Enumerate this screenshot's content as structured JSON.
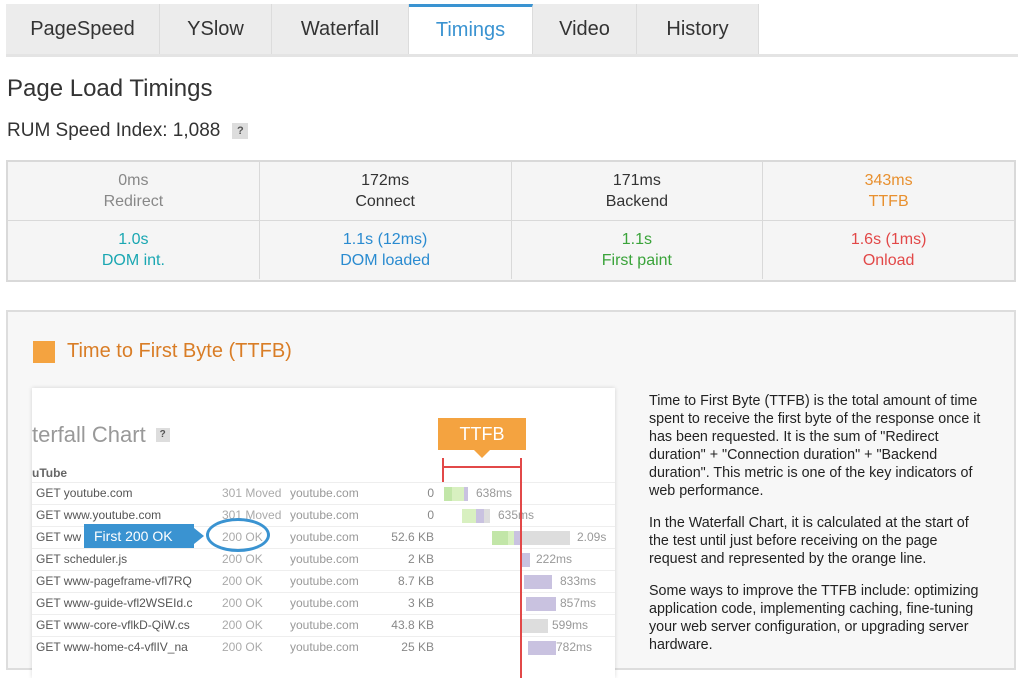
{
  "tabs": [
    "PageSpeed",
    "YSlow",
    "Waterfall",
    "Timings",
    "Video",
    "History"
  ],
  "active_tab": "Timings",
  "page_title": "Page Load Timings",
  "rum": {
    "label": "RUM Speed Index: 1,088",
    "help": "?"
  },
  "timings": {
    "row1": [
      {
        "value": "0ms",
        "label": "Redirect",
        "color": "#888888"
      },
      {
        "value": "172ms",
        "label": "Connect",
        "color": "#333333"
      },
      {
        "value": "171ms",
        "label": "Backend",
        "color": "#333333"
      },
      {
        "value": "343ms",
        "label": "TTFB",
        "color": "#e8902f"
      }
    ],
    "row2": [
      {
        "value": "1.0s",
        "label": "DOM int.",
        "color": "#1aa7b2"
      },
      {
        "value": "1.1s (12ms)",
        "label": "DOM loaded",
        "color": "#2a8bd0"
      },
      {
        "value": "1.1s",
        "label": "First paint",
        "color": "#3aa33a"
      },
      {
        "value": "1.6s (1ms)",
        "label": "Onload",
        "color": "#e24848"
      }
    ]
  },
  "panel": {
    "title": "Time to First Byte (TTFB)",
    "accent": "#f4a340",
    "screenshot": {
      "title": "terfall Chart",
      "help": "?",
      "group": "uTube",
      "ttfb_tag": "TTFB",
      "callout": "First 200 OK",
      "rows": [
        {
          "req": "GET youtube.com",
          "status": "301 Moved",
          "domain": "youtube.com",
          "size": "0",
          "time": "638ms"
        },
        {
          "req": "GET www.youtube.com",
          "status": "301 Moved",
          "domain": "youtube.com",
          "size": "0",
          "time": "635ms"
        },
        {
          "req": "GET ww",
          "status": "200 OK",
          "domain": "youtube.com",
          "size": "52.6 KB",
          "time": "2.09s"
        },
        {
          "req": "GET scheduler.js",
          "status": "200 OK",
          "domain": "youtube.com",
          "size": "2 KB",
          "time": "222ms"
        },
        {
          "req": "GET www-pageframe-vfl7RQ",
          "status": "200 OK",
          "domain": "youtube.com",
          "size": "8.7 KB",
          "time": "833ms"
        },
        {
          "req": "GET www-guide-vfl2WSEId.c",
          "status": "200 OK",
          "domain": "youtube.com",
          "size": "3 KB",
          "time": "857ms"
        },
        {
          "req": "GET www-core-vflkD-QiW.cs",
          "status": "200 OK",
          "domain": "youtube.com",
          "size": "43.8 KB",
          "time": "599ms"
        },
        {
          "req": "GET www-home-c4-vflIV_na",
          "status": "200 OK",
          "domain": "youtube.com",
          "size": "25 KB",
          "time": "782ms"
        }
      ]
    },
    "description": [
      "Time to First Byte (TTFB) is the total amount of time spent to receive the first byte of the response once it has been requested. It is the sum of \"Redirect duration\" + \"Connection duration\" + \"Backend duration\". This metric is one of the key indicators of web performance.",
      "In the Waterfall Chart, it is calculated at the start of the test until just before receiving on the page request and represented by the orange line.",
      "Some ways to improve the TTFB include: optimizing application code, implementing caching, fine-tuning your web server configuration, or upgrading server hardware."
    ]
  }
}
